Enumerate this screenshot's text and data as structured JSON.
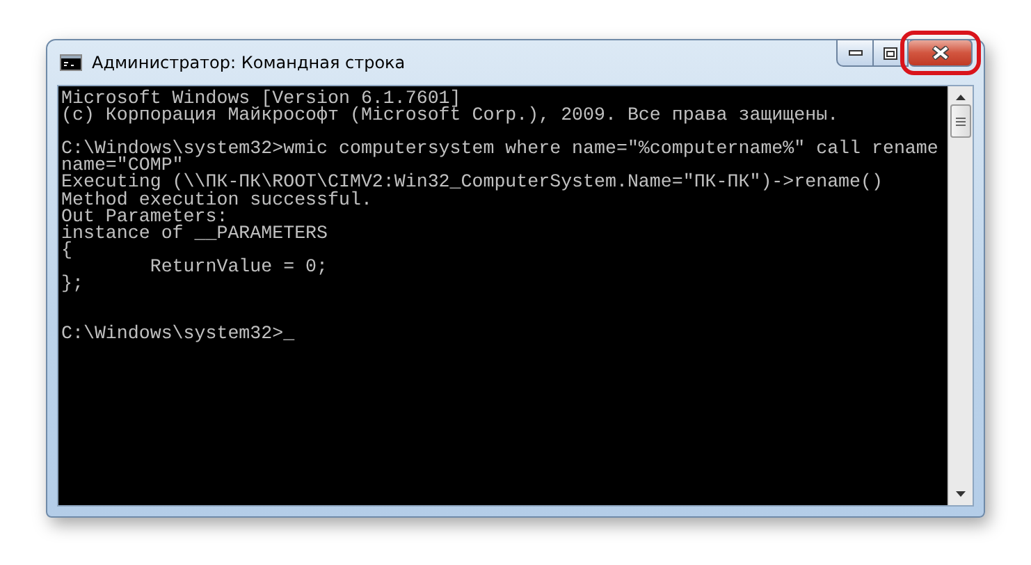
{
  "window": {
    "title": "Администратор: Командная строка",
    "controls": [
      {
        "kind": "minimize",
        "highlighted": false
      },
      {
        "kind": "maximize",
        "highlighted": false
      },
      {
        "kind": "close",
        "highlighted": true
      }
    ]
  },
  "console": {
    "lines": [
      {
        "kind": "text",
        "text": "Microsoft Windows [Version 6.1.7601]"
      },
      {
        "kind": "text",
        "text": "(c) Корпорация Майкрософт (Microsoft Corp.), 2009. Все права защищены."
      },
      {
        "kind": "blank"
      },
      {
        "kind": "text",
        "text": "C:\\Windows\\system32>wmic computersystem where name=\"%computername%\" call rename"
      },
      {
        "kind": "text",
        "text": "name=\"COMP\""
      },
      {
        "kind": "text",
        "text": "Executing (\\\\ПК-ПК\\ROOT\\CIMV2:Win32_ComputerSystem.Name=\"ПК-ПК\")->rename()"
      },
      {
        "kind": "text",
        "text": "Method execution successful."
      },
      {
        "kind": "text",
        "text": "Out Parameters:"
      },
      {
        "kind": "text",
        "text": "instance of __PARAMETERS"
      },
      {
        "kind": "text",
        "text": "{"
      },
      {
        "kind": "text",
        "text": "        ReturnValue = 0;"
      },
      {
        "kind": "text",
        "text": "};"
      },
      {
        "kind": "blank"
      },
      {
        "kind": "blank"
      },
      {
        "kind": "text",
        "text": "C:\\Windows\\system32>_"
      }
    ]
  }
}
